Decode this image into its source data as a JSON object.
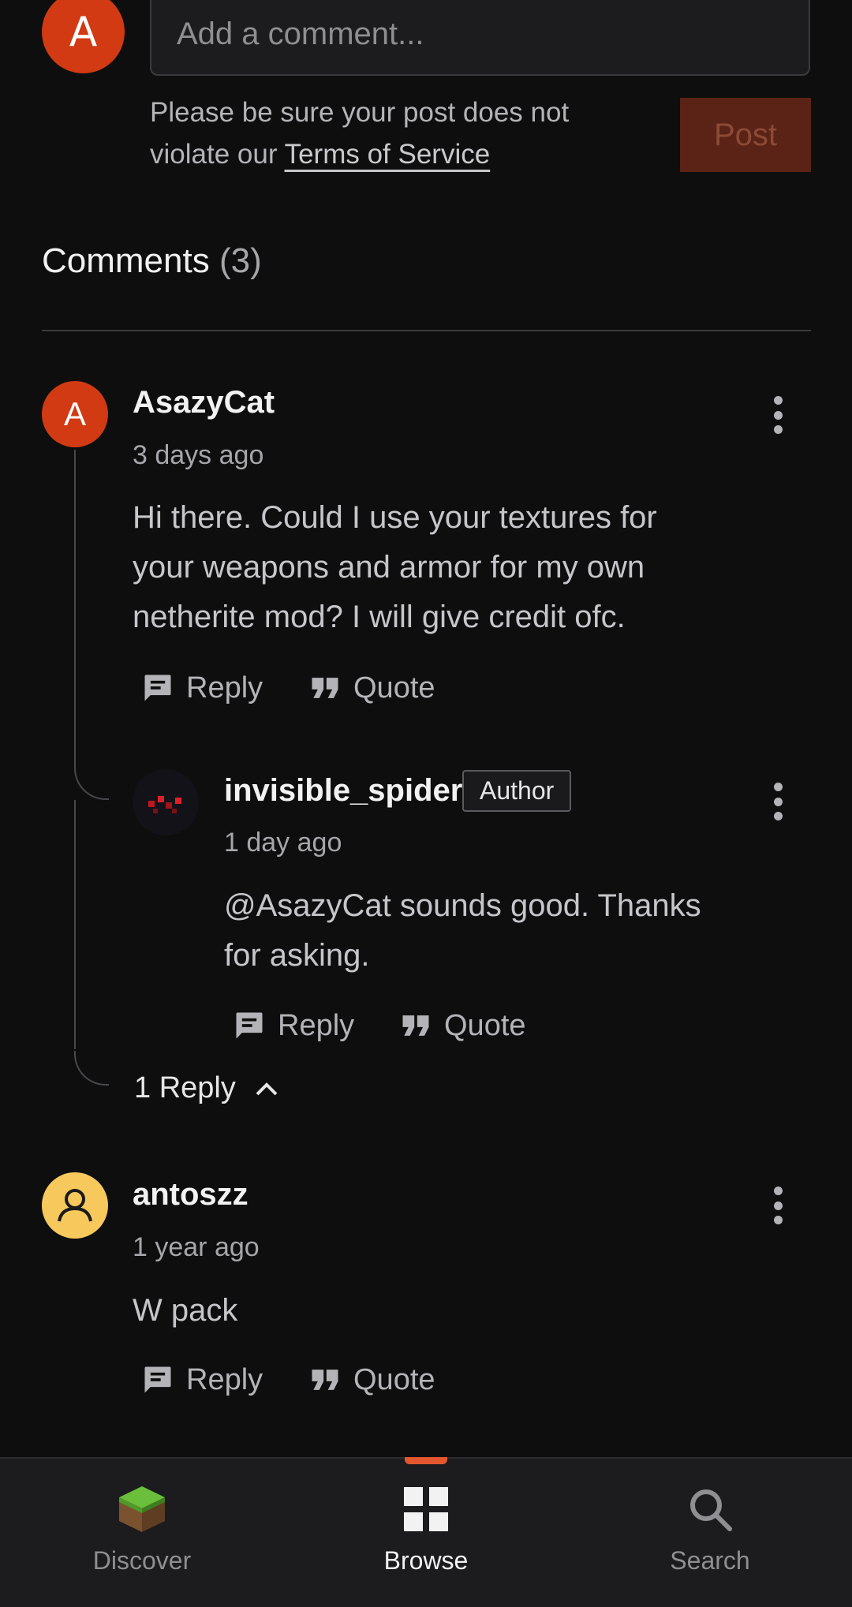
{
  "composer": {
    "avatar_letter": "A",
    "placeholder": "Add a comment...",
    "tos_prefix": "Please be sure your post does not violate our ",
    "tos_link": "Terms of Service",
    "post_label": "Post"
  },
  "comments_section": {
    "heading": "Comments",
    "count": "(3)"
  },
  "comments": [
    {
      "avatar_letter": "A",
      "username": "AsazyCat",
      "timestamp": "3 days ago",
      "text": "Hi there. Could I use your textures for your weapons and armor for my own netherite mod? I will give credit ofc.",
      "reply_label": "Reply",
      "quote_label": "Quote"
    },
    {
      "username": "invisible_spider",
      "badge": "Author",
      "timestamp": "1 day ago",
      "text": "@AsazyCat sounds good. Thanks for asking.",
      "reply_label": "Reply",
      "quote_label": "Quote"
    },
    {
      "username": "antoszz",
      "timestamp": "1 year ago",
      "text": "W pack",
      "reply_label": "Reply",
      "quote_label": "Quote"
    }
  ],
  "replies_toggle": "1 Reply",
  "nav": {
    "items": [
      {
        "label": "Discover",
        "icon": "grass-block-icon"
      },
      {
        "label": "Browse",
        "icon": "grid-icon"
      },
      {
        "label": "Search",
        "icon": "search-icon"
      }
    ],
    "active_index": 1
  },
  "colors": {
    "accent": "#d13a13",
    "background": "#0e0e0f"
  }
}
